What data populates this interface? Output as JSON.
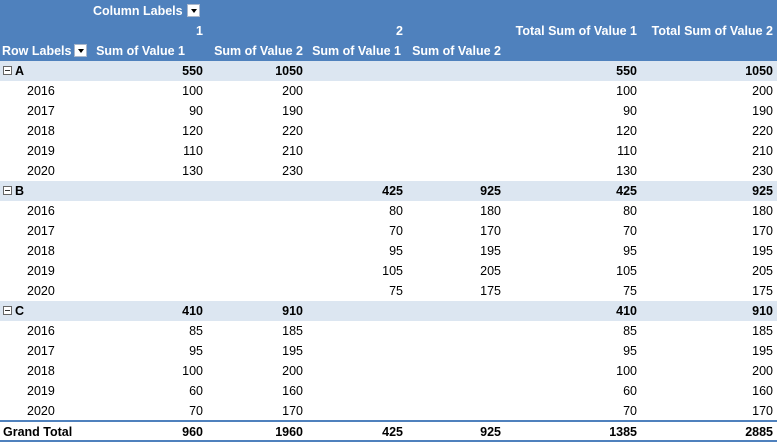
{
  "header": {
    "column_labels": "Column Labels",
    "row_labels": "Row Labels",
    "col_group_1": "1",
    "col_group_2": "2",
    "measures": [
      "Sum of Value 1",
      "Sum of Value 2",
      "Sum of Value 1",
      "Sum of Value 2",
      "Total Sum of Value 1",
      "Total Sum of Value 2"
    ]
  },
  "groups": [
    {
      "label": "A",
      "totals": [
        "550",
        "1050",
        "",
        "",
        "550",
        "1050"
      ],
      "rows": [
        {
          "year": "2016",
          "vals": [
            "100",
            "200",
            "",
            "",
            "100",
            "200"
          ]
        },
        {
          "year": "2017",
          "vals": [
            "90",
            "190",
            "",
            "",
            "90",
            "190"
          ]
        },
        {
          "year": "2018",
          "vals": [
            "120",
            "220",
            "",
            "",
            "120",
            "220"
          ]
        },
        {
          "year": "2019",
          "vals": [
            "110",
            "210",
            "",
            "",
            "110",
            "210"
          ]
        },
        {
          "year": "2020",
          "vals": [
            "130",
            "230",
            "",
            "",
            "130",
            "230"
          ]
        }
      ]
    },
    {
      "label": "B",
      "totals": [
        "",
        "",
        "425",
        "925",
        "425",
        "925"
      ],
      "rows": [
        {
          "year": "2016",
          "vals": [
            "",
            "",
            "80",
            "180",
            "80",
            "180"
          ]
        },
        {
          "year": "2017",
          "vals": [
            "",
            "",
            "70",
            "170",
            "70",
            "170"
          ]
        },
        {
          "year": "2018",
          "vals": [
            "",
            "",
            "95",
            "195",
            "95",
            "195"
          ]
        },
        {
          "year": "2019",
          "vals": [
            "",
            "",
            "105",
            "205",
            "105",
            "205"
          ]
        },
        {
          "year": "2020",
          "vals": [
            "",
            "",
            "75",
            "175",
            "75",
            "175"
          ]
        }
      ]
    },
    {
      "label": "C",
      "totals": [
        "410",
        "910",
        "",
        "",
        "410",
        "910"
      ],
      "rows": [
        {
          "year": "2016",
          "vals": [
            "85",
            "185",
            "",
            "",
            "85",
            "185"
          ]
        },
        {
          "year": "2017",
          "vals": [
            "95",
            "195",
            "",
            "",
            "95",
            "195"
          ]
        },
        {
          "year": "2018",
          "vals": [
            "100",
            "200",
            "",
            "",
            "100",
            "200"
          ]
        },
        {
          "year": "2019",
          "vals": [
            "60",
            "160",
            "",
            "",
            "60",
            "160"
          ]
        },
        {
          "year": "2020",
          "vals": [
            "70",
            "170",
            "",
            "",
            "70",
            "170"
          ]
        }
      ]
    }
  ],
  "grand_total": {
    "label": "Grand Total",
    "vals": [
      "960",
      "1960",
      "425",
      "925",
      "1385",
      "2885"
    ]
  },
  "colors": {
    "header_bg": "#4f81bd",
    "group_row_bg": "#dce6f1",
    "header_text": "#ffffff"
  }
}
